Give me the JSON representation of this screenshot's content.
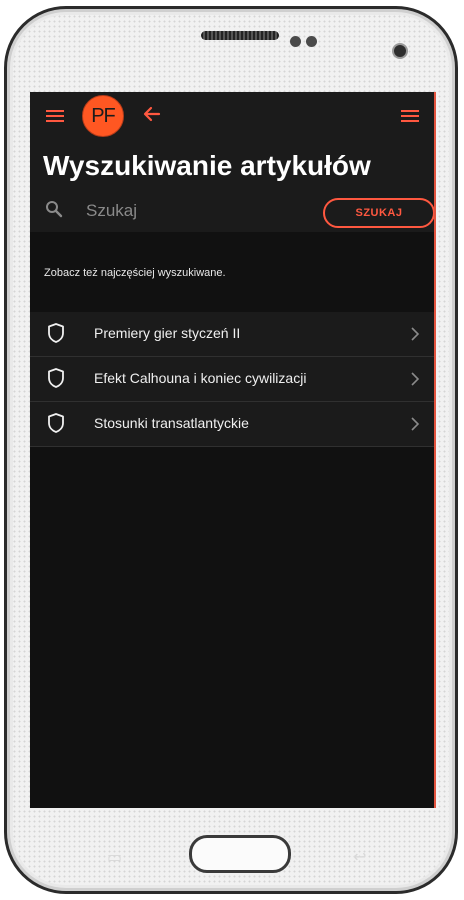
{
  "app": {
    "avatar_text": "PF",
    "accent_color": "#ff5840",
    "page_title": "Wyszukiwanie artykułów"
  },
  "search": {
    "placeholder": "Szukaj",
    "value": "",
    "button_label": "SZUKAJ"
  },
  "hint_text": "Zobacz też najczęściej wyszukiwane.",
  "articles": [
    {
      "title": "Premiery gier styczeń II",
      "icon": "shield-icon"
    },
    {
      "title": "Efekt Calhouna i koniec cywilizacji",
      "icon": "shield-icon"
    },
    {
      "title": "Stosunki transatlantyckie",
      "icon": "shield-icon"
    }
  ]
}
